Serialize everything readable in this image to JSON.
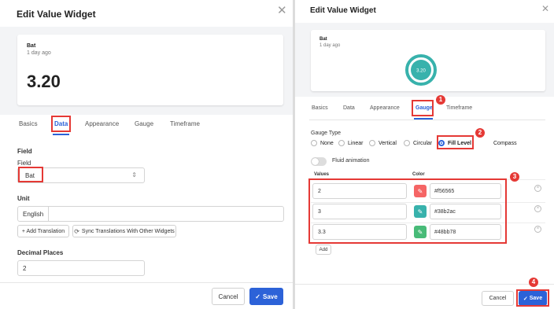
{
  "left": {
    "title": "Edit Value Widget",
    "card": {
      "name": "Bat",
      "subtitle": "1 day ago",
      "value": "3.20"
    },
    "tabs": [
      "Basics",
      "Data",
      "Appearance",
      "Gauge",
      "Timeframe"
    ],
    "field_section": "Field",
    "field_label": "Field",
    "field_value": "Bat",
    "unit_section": "Unit",
    "unit_value": "English",
    "add_translation": "+ Add Translation",
    "sync_translations": "Sync Translations With Other Widgets",
    "decimal_section": "Decimal Places",
    "decimal_value": "2",
    "cancel": "Cancel",
    "save": "Save"
  },
  "right": {
    "title": "Edit Value Widget",
    "card": {
      "name": "Bat",
      "subtitle": "1 day ago",
      "gauge_value": "3.20"
    },
    "tabs": [
      "Basics",
      "Data",
      "Appearance",
      "Gauge",
      "Timeframe"
    ],
    "gauge_type_label": "Gauge Type",
    "gauge_types": [
      "None",
      "Linear",
      "Vertical",
      "Circular",
      "Fill Level",
      "Compass"
    ],
    "selected_gauge_type": "Fill Level",
    "fluid_animation": "Fluid animation",
    "values_header": "Values",
    "color_header": "Color",
    "rows": [
      {
        "value": "2",
        "color": "#f56565"
      },
      {
        "value": "3",
        "color": "#38b2ac"
      },
      {
        "value": "3.3",
        "color": "#48bb78"
      }
    ],
    "add": "Add",
    "cancel": "Cancel",
    "save": "Save"
  },
  "badges": [
    "1",
    "2",
    "3",
    "4"
  ],
  "colors": {
    "accent": "#2c62d8",
    "highlight": "#e53935",
    "gauge_ring": "#38b2ac"
  }
}
